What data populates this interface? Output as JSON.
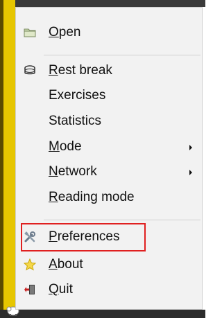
{
  "menu": {
    "open": {
      "rest": "pen",
      "mnemonic": "O",
      "icon": "folder-icon"
    },
    "rest_break": {
      "mnemonic": "R",
      "rest": "est break",
      "icon": "rest-break-icon"
    },
    "exercises": {
      "label": "Exercises"
    },
    "statistics": {
      "label": "Statistics"
    },
    "mode": {
      "mnemonic": "M",
      "rest": "ode",
      "has_submenu": true
    },
    "network": {
      "mnemonic": "N",
      "rest": "etwork",
      "has_submenu": true
    },
    "reading_mode": {
      "mnemonic": "R",
      "rest": "eading mode"
    },
    "preferences": {
      "mnemonic": "P",
      "rest": "references",
      "icon": "preferences-icon"
    },
    "about": {
      "mnemonic": "A",
      "rest": "bout",
      "icon": "star-icon"
    },
    "quit": {
      "mnemonic": "Q",
      "rest": "uit",
      "icon": "quit-icon"
    }
  },
  "colors": {
    "highlight": "#e02020",
    "taskbar_yellow": "#e6c600",
    "menu_bg": "#f2f2f2"
  }
}
